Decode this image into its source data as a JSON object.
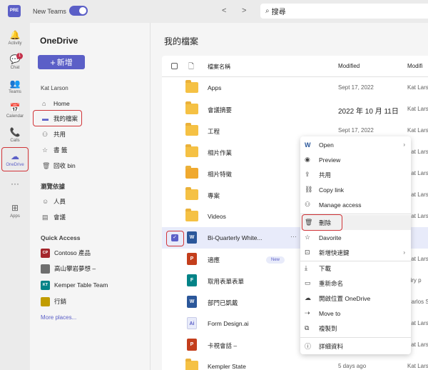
{
  "topbar": {
    "logo_text": "PRE",
    "new_teams_label": "New Teams",
    "back_icon": "<",
    "forward_icon": ">",
    "search_value": "搜尋"
  },
  "rail": [
    {
      "label": "Activity",
      "icon": "bell-icon",
      "glyph": "🔔"
    },
    {
      "label": "Chat",
      "icon": "chat-icon",
      "glyph": "💬",
      "badge": "1"
    },
    {
      "label": "Teams",
      "icon": "teams-icon",
      "glyph": "👥"
    },
    {
      "label": "Calendar",
      "icon": "calendar-icon",
      "glyph": "📅"
    },
    {
      "label": "Calls",
      "icon": "phone-icon",
      "glyph": "📞"
    },
    {
      "label": "OneDrive",
      "icon": "cloud-icon",
      "glyph": "☁"
    },
    {
      "label": "",
      "icon": "more-icon",
      "glyph": "···"
    },
    {
      "label": "Apps",
      "icon": "plus-box-icon",
      "glyph": "⊞"
    }
  ],
  "leftnav": {
    "title": "OneDrive",
    "new_button": "新增",
    "user": "Kat Larson",
    "items": [
      {
        "label": "Home",
        "glyph": "⌂"
      },
      {
        "label": "我的檔案",
        "glyph": "▬"
      },
      {
        "label": "共用",
        "glyph": "⚇"
      },
      {
        "label": "書 籤",
        "glyph": "☆"
      },
      {
        "label": "回收       bin",
        "glyph": "🗑"
      }
    ],
    "browse_section": "瀏覽依據",
    "browse_items": [
      {
        "label": "人員",
        "glyph": "☺"
      },
      {
        "label": "會議",
        "glyph": "▤"
      }
    ],
    "quick_access_section": "Quick Access",
    "quick_access": [
      {
        "badge": "CP",
        "label": "Contoso 產品",
        "color": "#a4262c"
      },
      {
        "badge": "",
        "label": "高山攀岩夢想 –",
        "color": "#6e6e6e"
      },
      {
        "badge": "KT",
        "label": "Kemper Table Team",
        "color": "#038387"
      },
      {
        "badge": "",
        "label": "行銷",
        "color": "#c19c00"
      }
    ],
    "more_places": "More places..."
  },
  "main": {
    "title": "我的檔案",
    "columns": {
      "name": "檔案名稱",
      "modified": "Modified",
      "modified_by": "Modifi"
    },
    "rows": [
      {
        "type": "folder",
        "name": "Apps",
        "modified": "Sept 17, 2022",
        "by": "Kat Lars"
      },
      {
        "type": "folder",
        "name": "會議摘要",
        "modified": "2022 年 10 月 11日",
        "by": "Kat Lars"
      },
      {
        "type": "folder",
        "name": "工程",
        "modified": "Sept 17, 2022",
        "by": "Kat Lars"
      },
      {
        "type": "folder",
        "name": "相片作業",
        "modified": "",
        "by": "Kat Lars"
      },
      {
        "type": "folder-shared",
        "name": "相片特徵",
        "modified": "",
        "by": "Kat Lars"
      },
      {
        "type": "folder",
        "name": "專案",
        "modified": "",
        "by": "Kat Lars"
      },
      {
        "type": "folder",
        "name": "Videos",
        "modified": "",
        "by": "Kat Lars"
      },
      {
        "type": "word",
        "name": "Bi-Quarterly White...",
        "modified": "",
        "by": "",
        "selected": true,
        "dots": "···"
      },
      {
        "type": "ppt",
        "name": "適應",
        "modified": "",
        "by": "Kat Lars",
        "pill": "New"
      },
      {
        "type": "form",
        "name": "取用表單表單",
        "modified": "",
        "by": "airy p"
      },
      {
        "type": "word",
        "name": "部門已凱戴",
        "modified": "",
        "by": "Carlos S"
      },
      {
        "type": "ai",
        "name": "Form Design.ai",
        "modified": "",
        "by": "Kat Lars"
      },
      {
        "type": "ppt",
        "name": "卡視會話 –",
        "modified": "",
        "by": "Kat Lars"
      },
      {
        "type": "folder",
        "name": "Kempler State",
        "modified": "5 days ago",
        "by": "Kat Lars"
      }
    ]
  },
  "menu": [
    {
      "label": "Open",
      "glyph": "W",
      "chevron": "›"
    },
    {
      "label": "Preview",
      "glyph": "◉"
    },
    {
      "label": "共用",
      "glyph": "⇪"
    },
    {
      "label": "Copy link",
      "glyph": "⛓"
    },
    {
      "label": "Manage access",
      "glyph": "⚇"
    },
    {
      "label": "刪除",
      "glyph": "🗑"
    },
    {
      "label": "Davorite",
      "glyph": "☆"
    },
    {
      "label": "新增快速鍵",
      "glyph": "⊡",
      "chevron": "›"
    },
    {
      "label": "下載",
      "glyph": "⤓"
    },
    {
      "label": "重新命名",
      "glyph": "▭"
    },
    {
      "label": "開啟位置 OneDrive",
      "glyph": "☁"
    },
    {
      "label": "Move to",
      "glyph": "⇢"
    },
    {
      "label": "複製到",
      "glyph": "⧉"
    },
    {
      "label": "詳細資料",
      "glyph": "ⓘ"
    }
  ],
  "colors": {
    "accent": "#5b5fc7",
    "highlight_box": "#d13438",
    "folder": "#f5c144"
  }
}
